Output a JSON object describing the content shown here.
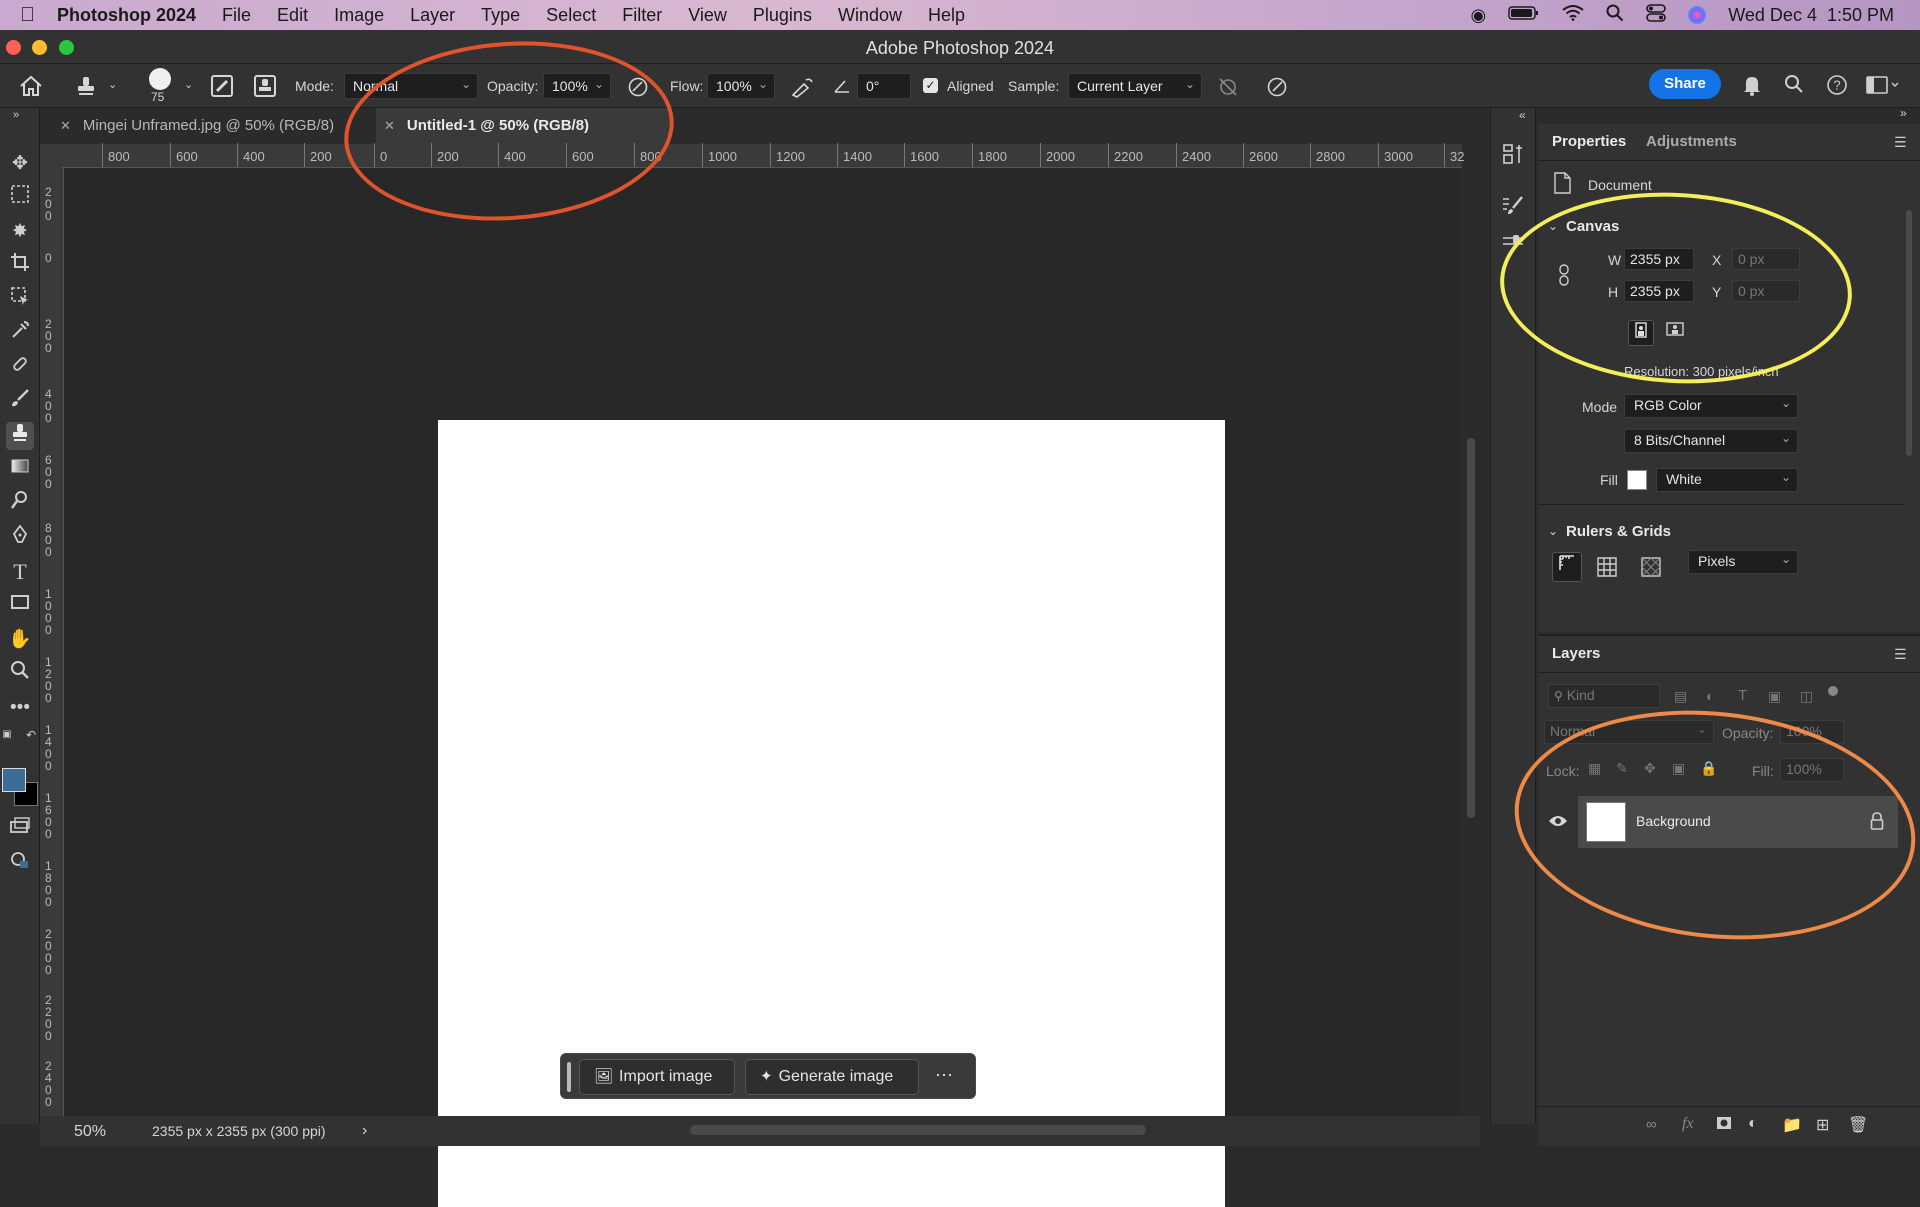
{
  "menubar": {
    "app_name": "Photoshop 2024",
    "items": [
      "File",
      "Edit",
      "Image",
      "Layer",
      "Type",
      "Select",
      "Filter",
      "View",
      "Plugins",
      "Window",
      "Help"
    ],
    "datetime": "Wed Dec 4  1:50 PM"
  },
  "window": {
    "title": "Adobe Photoshop 2024"
  },
  "options_bar": {
    "brush_size": "75",
    "mode_label": "Mode:",
    "mode_value": "Normal",
    "opacity_label": "Opacity:",
    "opacity_value": "100%",
    "flow_label": "Flow:",
    "flow_value": "100%",
    "angle_value": "0°",
    "aligned_label": "Aligned",
    "aligned_checked": true,
    "sample_label": "Sample:",
    "sample_value": "Current Layer",
    "share_label": "Share"
  },
  "tabs": [
    {
      "label": "Mingei Unframed.jpg @ 50% (RGB/8)",
      "active": false
    },
    {
      "label": "Untitled-1 @ 50% (RGB/8)",
      "active": true
    }
  ],
  "ruler": {
    "h_ticks": [
      "800",
      "600",
      "400",
      "200",
      "0",
      "200",
      "400",
      "600",
      "800",
      "1000",
      "1200",
      "1400",
      "1600",
      "1800",
      "2000",
      "2200",
      "2400",
      "2600",
      "2800",
      "3000",
      "32"
    ],
    "v_ticks": [
      "2\n0\n0",
      "0",
      "2\n0\n0",
      "4\n0\n0",
      "6\n0\n0",
      "8\n0\n0",
      "1\n0\n0\n0",
      "1\n2\n0\n0",
      "1\n4\n0\n0",
      "1\n6\n0\n0",
      "1\n8\n0\n0",
      "2\n0\n0\n0",
      "2\n2\n0\n0",
      "2\n4\n0\n0"
    ]
  },
  "context_bar": {
    "import_label": "Import image",
    "generate_label": "Generate image",
    "more_label": "···"
  },
  "status": {
    "zoom": "50%",
    "doc_info": "2355 px x 2355 px (300 ppi)"
  },
  "properties": {
    "tabs": [
      "Properties",
      "Adjustments"
    ],
    "doc_label": "Document",
    "canvas_section": "Canvas",
    "w_label": "W",
    "w_value": "2355 px",
    "h_label": "H",
    "h_value": "2355 px",
    "x_label": "X",
    "x_value": "0 px",
    "y_label": "Y",
    "y_value": "0 px",
    "resolution": "Resolution: 300 pixels/inch",
    "mode_label": "Mode",
    "mode_value": "RGB Color",
    "bits_value": "8 Bits/Channel",
    "fill_label": "Fill",
    "fill_value": "White",
    "rulers_section": "Rulers & Grids",
    "units_value": "Pixels"
  },
  "layers": {
    "title": "Layers",
    "kind_placeholder": "Kind",
    "blend_value": "Normal",
    "opacity_label": "Opacity:",
    "opacity_value": "100%",
    "lock_label": "Lock:",
    "fill_label": "Fill:",
    "fill_value": "100%",
    "items": [
      {
        "name": "Background",
        "visible": true,
        "locked": true
      }
    ]
  },
  "colors": {
    "foreground": "#3a6e96",
    "background": "#000000",
    "share": "#1473e6",
    "annotation_red": "#e0542c",
    "annotation_yellow": "#f2ef5a",
    "annotation_orange": "#ee8a48"
  }
}
